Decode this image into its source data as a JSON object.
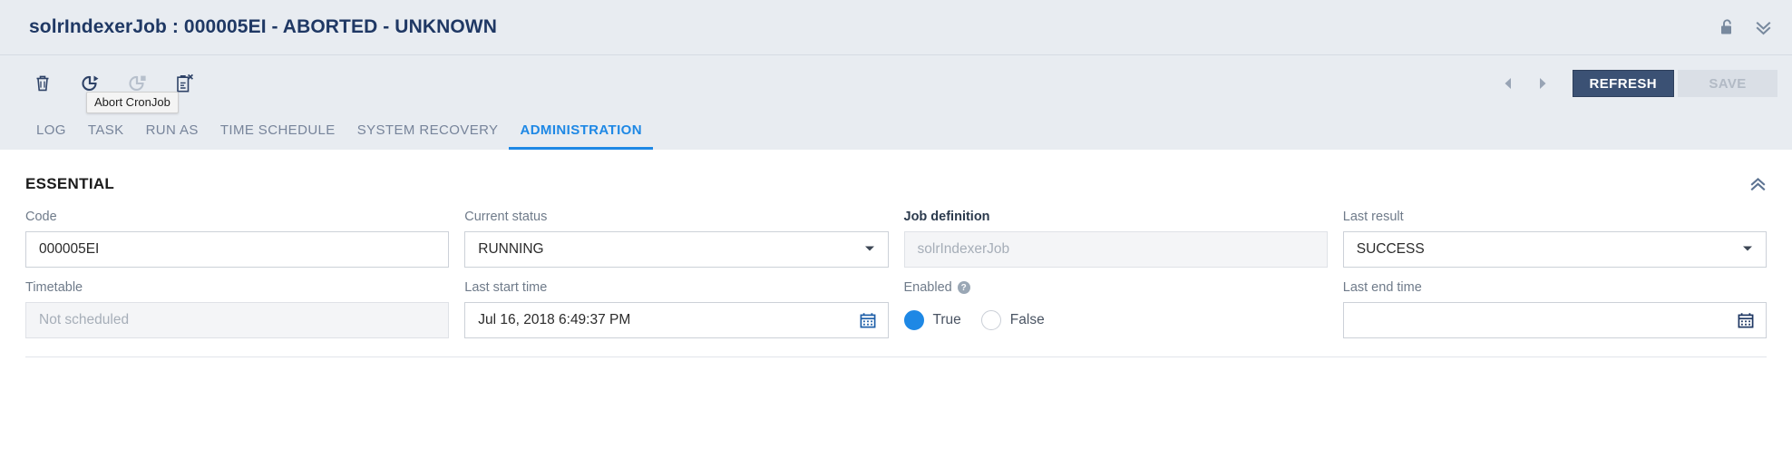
{
  "header": {
    "title": "solrIndexerJob : 000005EI - ABORTED - UNKNOWN",
    "lock_icon": "unlock-icon",
    "collapse_all_icon": "chevron-double-down-icon"
  },
  "toolbar": {
    "icons": [
      {
        "name": "delete-icon",
        "label": "Delete",
        "disabled": false
      },
      {
        "name": "run-cronjob-icon",
        "label": "Run CronJob",
        "disabled": false
      },
      {
        "name": "stop-cronjob-icon",
        "label": "Stop CronJob",
        "disabled": true
      },
      {
        "name": "abort-cronjob-icon",
        "label": "Abort CronJob",
        "disabled": false
      }
    ],
    "tooltip": "Abort CronJob",
    "prev_label": "Previous",
    "next_label": "Next",
    "refresh_label": "REFRESH",
    "save_label": "SAVE",
    "refresh_color": "#3b5174",
    "save_disabled": true
  },
  "tabs": [
    {
      "label": "LOG",
      "active": false
    },
    {
      "label": "TASK",
      "active": false
    },
    {
      "label": "RUN AS",
      "active": false
    },
    {
      "label": "TIME SCHEDULE",
      "active": false
    },
    {
      "label": "SYSTEM RECOVERY",
      "active": false
    },
    {
      "label": "ADMINISTRATION",
      "active": true
    }
  ],
  "accent_color": "#1e88e5",
  "section": {
    "title": "ESSENTIAL",
    "collapse_icon": "chevron-double-up-icon"
  },
  "fields": {
    "code": {
      "label": "Code",
      "value": "000005EI",
      "placeholder": ""
    },
    "current_status": {
      "label": "Current status",
      "value": "RUNNING",
      "options": [
        "RUNNING"
      ]
    },
    "job_definition": {
      "label": "Job definition",
      "value": "",
      "placeholder": "solrIndexerJob"
    },
    "last_result": {
      "label": "Last result",
      "value": "SUCCESS",
      "options": [
        "SUCCESS"
      ]
    },
    "timetable": {
      "label": "Timetable",
      "value": "",
      "placeholder": "Not scheduled"
    },
    "last_start_time": {
      "label": "Last start time",
      "value": "Jul 16, 2018 6:49:37 PM",
      "placeholder": ""
    },
    "enabled": {
      "label": "Enabled",
      "help": "?",
      "options": [
        {
          "label": "True",
          "checked": true
        },
        {
          "label": "False",
          "checked": false
        }
      ]
    },
    "last_end_time": {
      "label": "Last end time",
      "value": "",
      "placeholder": ""
    }
  }
}
